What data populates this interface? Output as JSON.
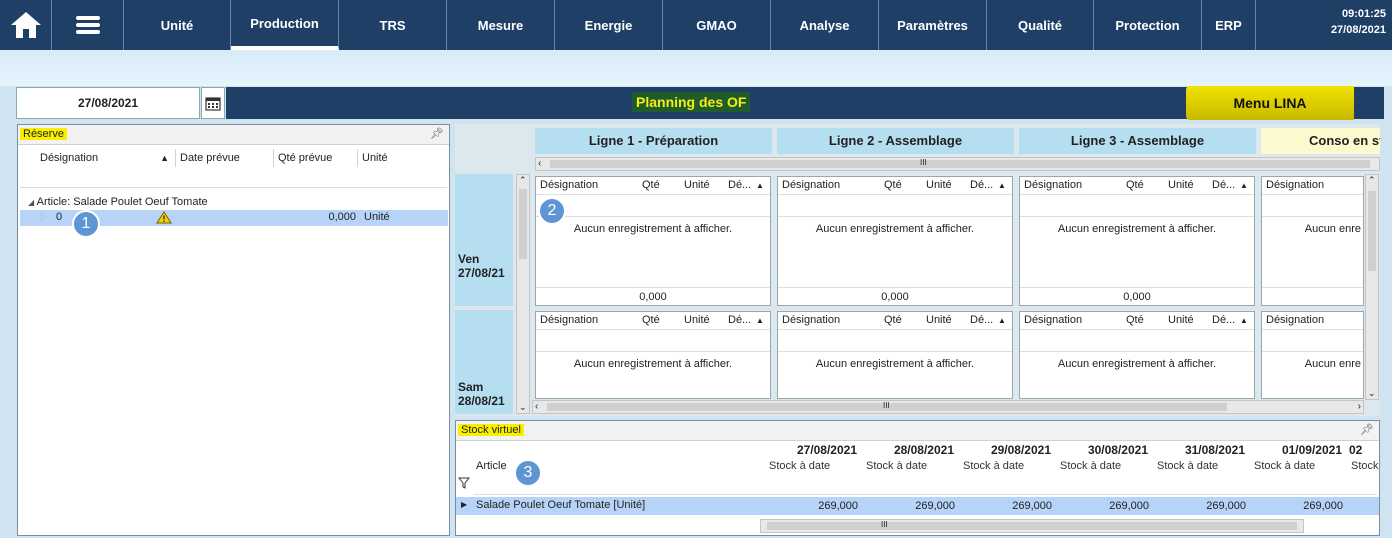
{
  "nav": {
    "items": [
      "Unité",
      "Production",
      "TRS",
      "Mesure",
      "Energie",
      "GMAO",
      "Analyse",
      "Paramètres",
      "Qualité",
      "Protection",
      "ERP"
    ],
    "time": "09:01:25",
    "date": "27/08/2021"
  },
  "toolbar": {
    "date": "27/08/2021",
    "page_title": "Planning des OF",
    "menu_button": "Menu LINA"
  },
  "reserve": {
    "title": "Réserve",
    "columns": [
      "Désignation",
      "Date prévue",
      "Qté prévue",
      "Unité"
    ],
    "group": "Article: Salade Poulet Oeuf Tomate",
    "row": {
      "designation": "0",
      "qty": "0,000",
      "unit": "Unité"
    }
  },
  "planning": {
    "lines": [
      "Ligne 1 - Préparation",
      "Ligne 2 - Assemblage",
      "Ligne 3 - Assemblage",
      "Conso en st"
    ],
    "days": [
      {
        "name": "Ven",
        "date": "27/08/21"
      },
      {
        "name": "Sam",
        "date": "28/08/21"
      }
    ],
    "cell_columns": [
      "Désignation",
      "Qté",
      "Unité",
      "Dé..."
    ],
    "empty_text": "Aucun enregistrement à afficher.",
    "empty_text_partial": "Aucun enre",
    "total": "0,000",
    "scroll_mark": "III"
  },
  "stock": {
    "title": "Stock virtuel",
    "dates": [
      "27/08/2021",
      "28/08/2021",
      "29/08/2021",
      "30/08/2021",
      "31/08/2021",
      "01/09/2021",
      "02"
    ],
    "sub_label": "Stock à date",
    "sub_label_partial": "Stock",
    "article_label": "Article",
    "row": {
      "name": "Salade Poulet Oeuf Tomate [Unité]",
      "values": [
        "269,000",
        "269,000",
        "269,000",
        "269,000",
        "269,000",
        "269,000"
      ]
    }
  },
  "badges": [
    "1",
    "2",
    "3"
  ]
}
